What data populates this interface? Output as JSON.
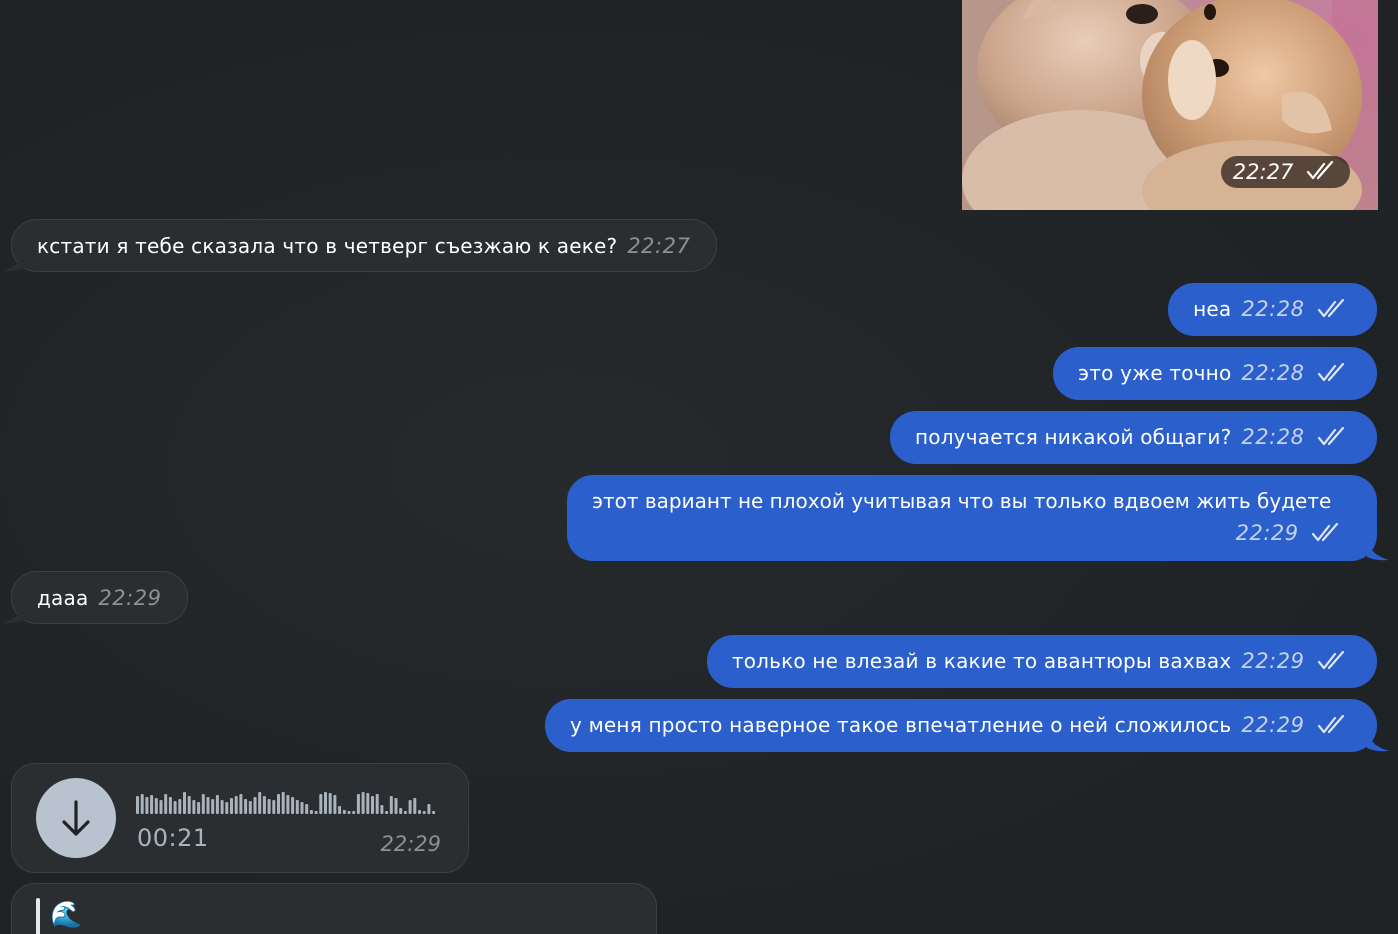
{
  "photo": {
    "time": "22:27"
  },
  "messages": [
    {
      "id": "m1",
      "direction": "in",
      "text": "кстати я тебе сказала что в четверг съезжаю к аеке?",
      "time": "22:27"
    },
    {
      "id": "m2",
      "direction": "out",
      "text": "неа",
      "time": "22:28",
      "status": "read"
    },
    {
      "id": "m3",
      "direction": "out",
      "text": "это уже точно",
      "time": "22:28",
      "status": "read"
    },
    {
      "id": "m4",
      "direction": "out",
      "text": "получается никакой общаги?",
      "time": "22:28",
      "status": "read"
    },
    {
      "id": "m5",
      "direction": "out",
      "text": "этот вариант не плохой учитывая что вы только вдвоем жить будете",
      "time": "22:29",
      "status": "read"
    },
    {
      "id": "m6",
      "direction": "in",
      "text": "дааа",
      "time": "22:29"
    },
    {
      "id": "m7",
      "direction": "out",
      "text": "только не влезай в какие то авантюры вахвах",
      "time": "22:29",
      "status": "read"
    },
    {
      "id": "m8",
      "direction": "out",
      "text": "у меня просто наверное такое впечатление о ней сложилось",
      "time": "22:29",
      "status": "read"
    }
  ],
  "voice": {
    "duration": "00:21",
    "time": "22:29",
    "icon": "download-arrow-icon"
  },
  "last_message": {
    "reply_emoji": "🌊"
  },
  "colors": {
    "background": "#202325",
    "incoming_bubble": "#2b2e30",
    "outgoing_bubble": "#2b5fcb",
    "timestamp_in": "#8c9194"
  }
}
